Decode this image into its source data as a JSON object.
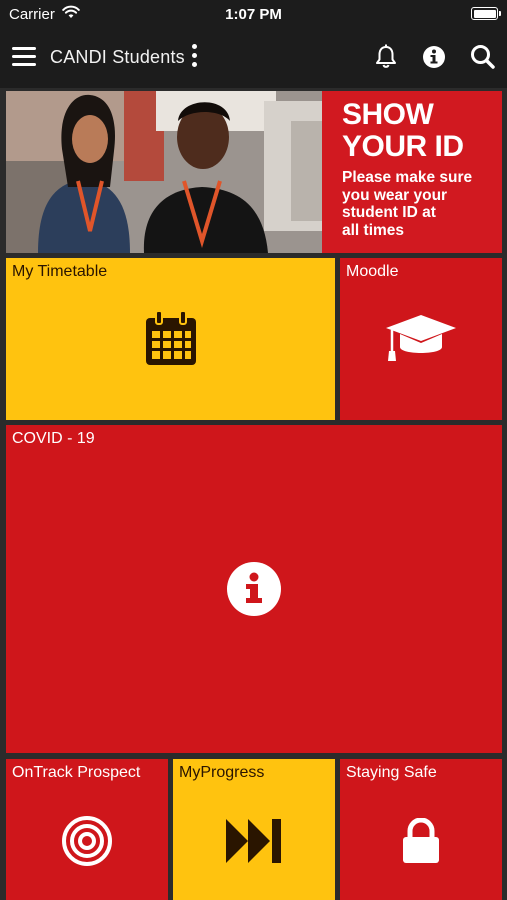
{
  "status_bar": {
    "carrier": "Carrier",
    "time": "1:07 PM"
  },
  "app_bar": {
    "title": "CANDI Students"
  },
  "banner": {
    "headline_line1": "SHOW",
    "headline_line2": "YOUR ID",
    "subtext_line1": "Please make sure",
    "subtext_line2": "you wear your",
    "subtext_line3": "student ID at",
    "subtext_line4": "all times"
  },
  "tiles": {
    "timetable": {
      "label": "My Timetable",
      "icon": "calendar-icon",
      "color": "#ffc30f"
    },
    "moodle": {
      "label": "Moodle",
      "icon": "graduation-cap-icon",
      "color": "#cf161b"
    },
    "covid": {
      "label": "COVID - 19",
      "icon": "info-icon",
      "color": "#cf161b"
    },
    "ontrack": {
      "label": "OnTrack Prospect",
      "icon": "target-icon",
      "color": "#cf161b"
    },
    "myprogress": {
      "label": "MyProgress",
      "icon": "fast-forward-icon",
      "color": "#ffc30f"
    },
    "staying_safe": {
      "label": "Staying Safe",
      "icon": "lock-icon",
      "color": "#cf161b"
    }
  }
}
